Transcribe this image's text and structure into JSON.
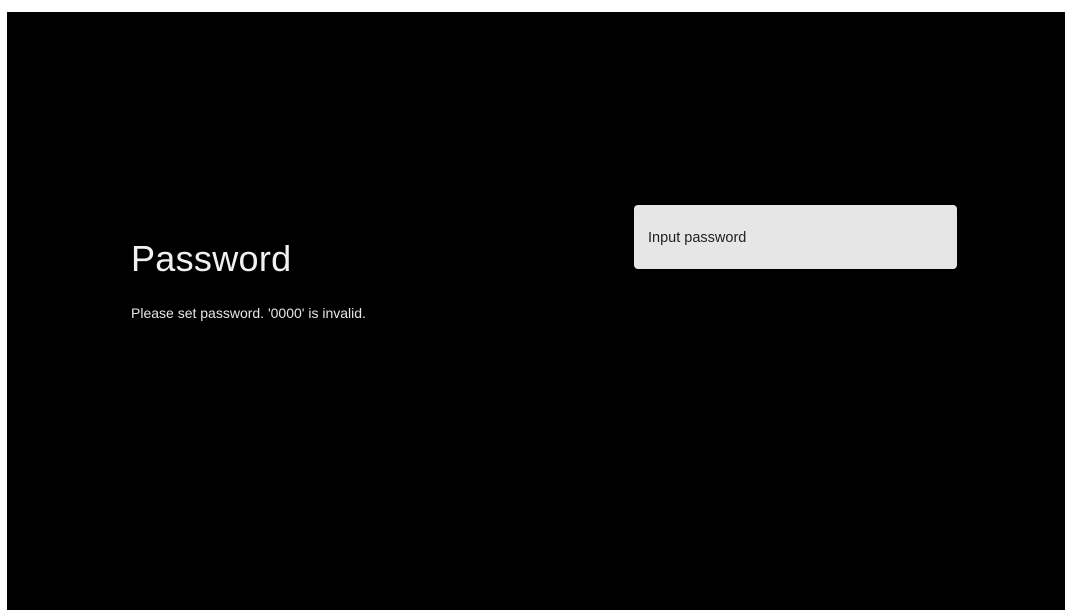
{
  "screen": {
    "title": "Password",
    "description": "Please set password. '0000' is invalid."
  },
  "password_option": {
    "label": "Input password"
  },
  "colors": {
    "background": "#000000",
    "card": "#e6e6e6",
    "title_text": "#f1f1f1",
    "card_text": "#202124"
  }
}
